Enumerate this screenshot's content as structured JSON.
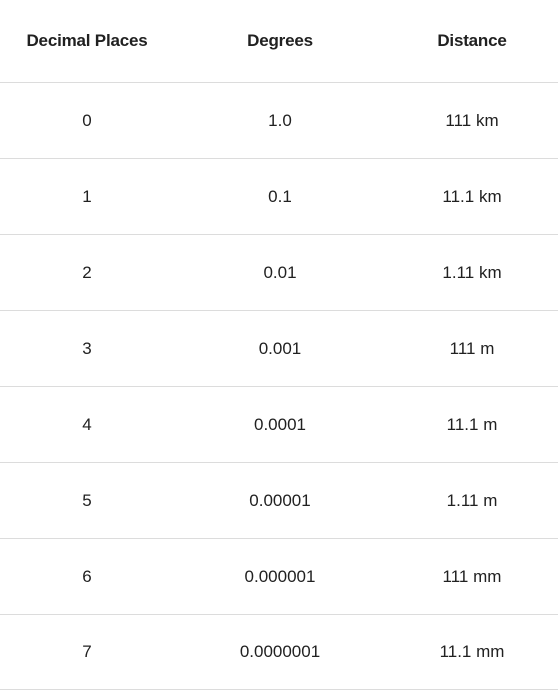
{
  "table": {
    "headers": [
      "Decimal Places",
      "Degrees",
      "Distance"
    ],
    "rows": [
      [
        "0",
        "1.0",
        "111 km"
      ],
      [
        "1",
        "0.1",
        "11.1 km"
      ],
      [
        "2",
        "0.01",
        "1.11 km"
      ],
      [
        "3",
        "0.001",
        "111 m"
      ],
      [
        "4",
        "0.0001",
        "11.1 m"
      ],
      [
        "5",
        "0.00001",
        "1.11 m"
      ],
      [
        "6",
        "0.000001",
        "111 mm"
      ],
      [
        "7",
        "0.0000001",
        "11.1 mm"
      ]
    ]
  }
}
